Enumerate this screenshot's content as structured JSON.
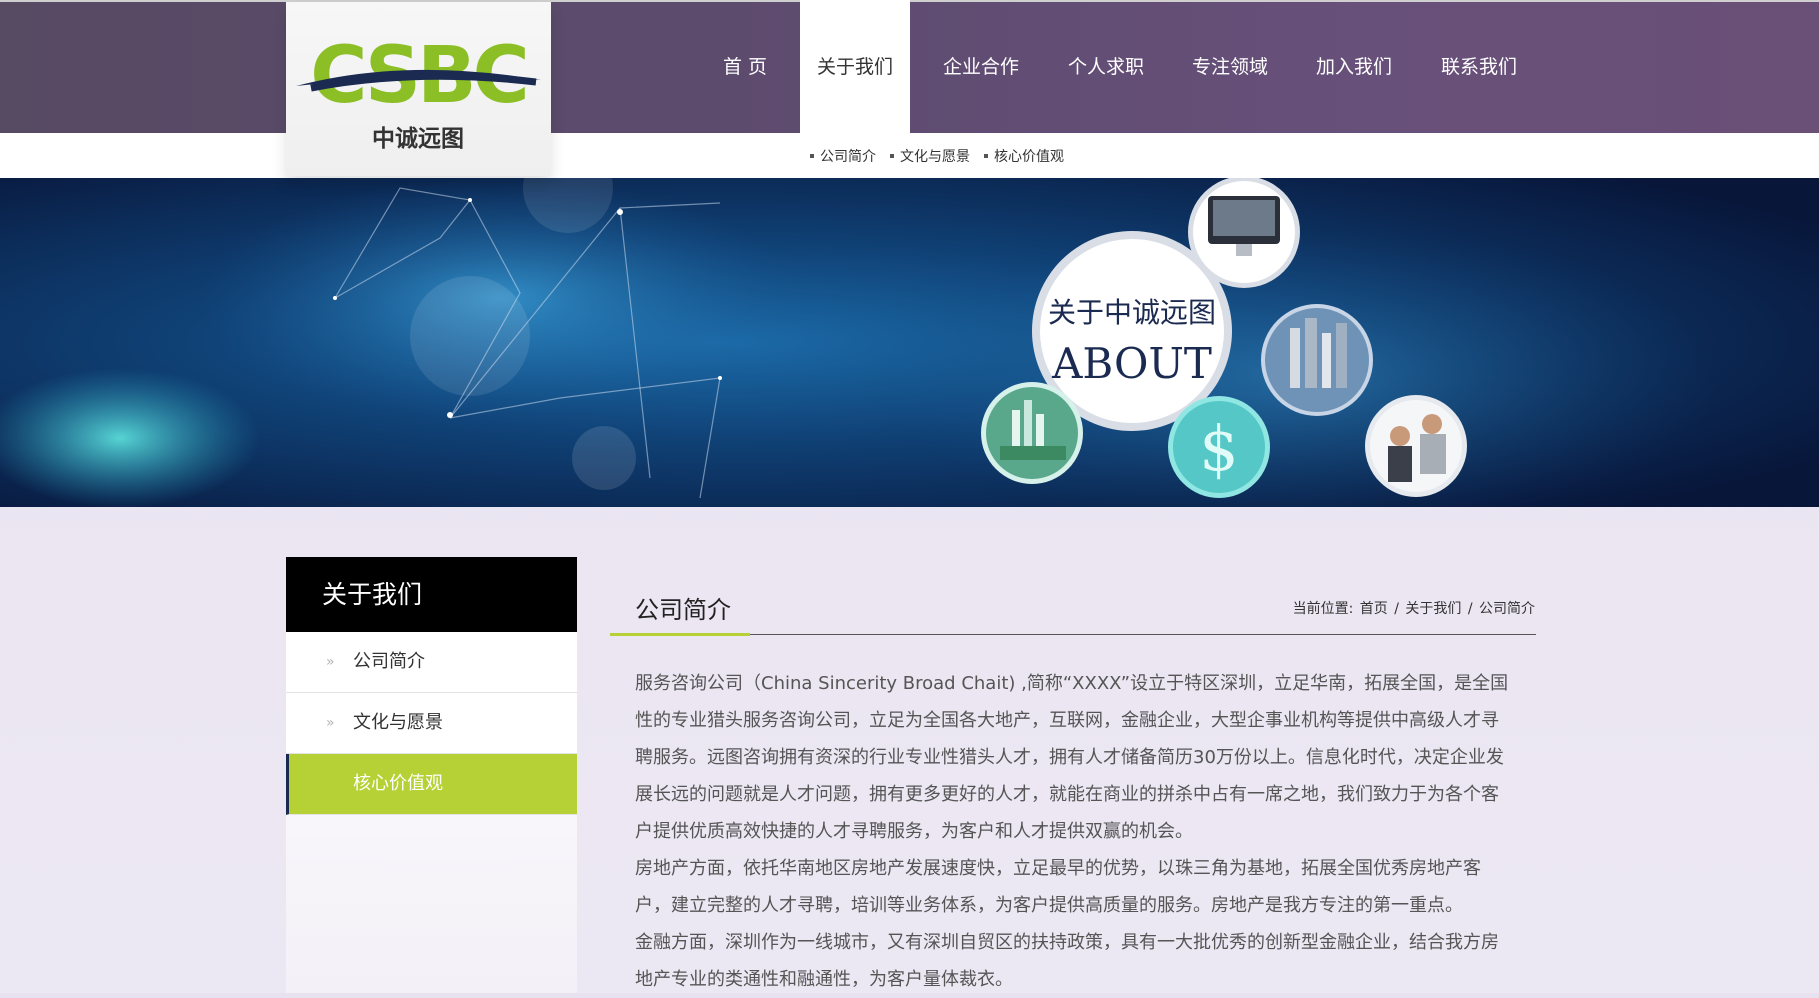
{
  "logo": {
    "letters": "CSBC",
    "name_cn": "中诚远图"
  },
  "nav": {
    "items": [
      {
        "label": "首 页",
        "width": 110
      },
      {
        "label": "关于我们",
        "width": 110,
        "active": true
      },
      {
        "label": "企业合作",
        "width": 142
      },
      {
        "label": "个人求职",
        "width": 108
      },
      {
        "label": "专注领域",
        "width": 140
      },
      {
        "label": "加入我们",
        "width": 108
      },
      {
        "label": "联系我们",
        "width": 142
      }
    ]
  },
  "subnav": {
    "items": [
      "公司简介",
      "文化与愿景",
      "核心价值观"
    ]
  },
  "banner": {
    "circle_cn": "关于中诚远图",
    "circle_en": "ABOUT"
  },
  "sidebar": {
    "title": "关于我们",
    "items": [
      {
        "label": "公司简介",
        "active": false
      },
      {
        "label": "文化与愿景",
        "active": false
      },
      {
        "label": "核心价值观",
        "active": true
      }
    ]
  },
  "content": {
    "title": "公司简介",
    "breadcrumb": {
      "prefix": "当前位置:",
      "home": "首页",
      "section": "关于我们",
      "page": "公司简介",
      "separator": "/"
    },
    "paragraphs": [
      "服务咨询公司（China Sincerity Broad Chait) ,简称“XXXX”设立于特区深圳，立足华南，拓展全国，是全国性的专业猎头服务咨询公司，立足为全国各大地产，互联网，金融企业，大型企事业机构等提供中高级人才寻聘服务。远图咨询拥有资深的行业专业性猎头人才，拥有人才储备简历30万份以上。信息化时代，决定企业发展长远的问题就是人才问题，拥有更多更好的人才，就能在商业的拼杀中占有一席之地，我们致力于为各个客户提供优质高效快捷的人才寻聘服务，为客户和人才提供双赢的机会。",
      "房地产方面，依托华南地区房地产发展速度快，立足最早的优势，以珠三角为基地，拓展全国优秀房地产客户，建立完整的人才寻聘，培训等业务体系，为客户提供高质量的服务。房地产是我方专注的第一重点。",
      "金融方面，深圳作为一线城市，又有深圳自贸区的扶持政策，具有一大批优秀的创新型金融企业，结合我方房地产专业的类通性和融通性，为客户量体裁衣。"
    ]
  },
  "colors": {
    "accent": "#b6d136",
    "header": "#5d4b6e",
    "logo_navy": "#1b2a50"
  }
}
